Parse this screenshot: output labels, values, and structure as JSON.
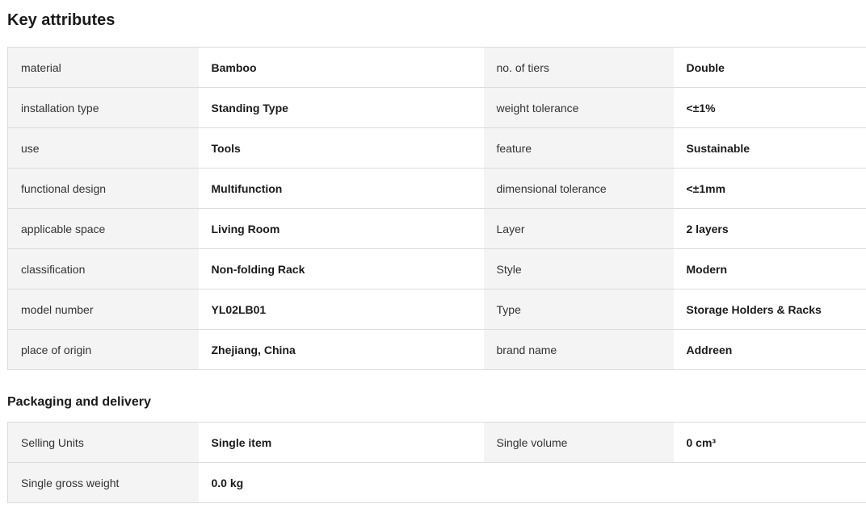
{
  "key_attributes": {
    "title": "Key attributes",
    "rows": [
      [
        {
          "label": "material",
          "value": "Bamboo"
        },
        {
          "label": "no. of tiers",
          "value": "Double"
        }
      ],
      [
        {
          "label": "installation type",
          "value": "Standing Type"
        },
        {
          "label": "weight tolerance",
          "value": "<±1%"
        }
      ],
      [
        {
          "label": "use",
          "value": "Tools"
        },
        {
          "label": "feature",
          "value": "Sustainable"
        }
      ],
      [
        {
          "label": "functional design",
          "value": "Multifunction"
        },
        {
          "label": "dimensional tolerance",
          "value": "<±1mm"
        }
      ],
      [
        {
          "label": "applicable space",
          "value": "Living Room"
        },
        {
          "label": "Layer",
          "value": "2 layers"
        }
      ],
      [
        {
          "label": "classification",
          "value": "Non-folding Rack"
        },
        {
          "label": "Style",
          "value": "Modern"
        }
      ],
      [
        {
          "label": "model number",
          "value": "YL02LB01"
        },
        {
          "label": "Type",
          "value": "Storage Holders & Racks"
        }
      ],
      [
        {
          "label": "place of origin",
          "value": "Zhejiang, China"
        },
        {
          "label": "brand name",
          "value": "Addreen"
        }
      ]
    ]
  },
  "packaging": {
    "title": "Packaging and delivery",
    "rows": [
      [
        {
          "label": "Selling Units",
          "value": "Single item"
        },
        {
          "label": "Single volume",
          "value": "0 cm³"
        }
      ],
      [
        {
          "label": "Single gross weight",
          "value": "0.0 kg"
        }
      ]
    ]
  }
}
